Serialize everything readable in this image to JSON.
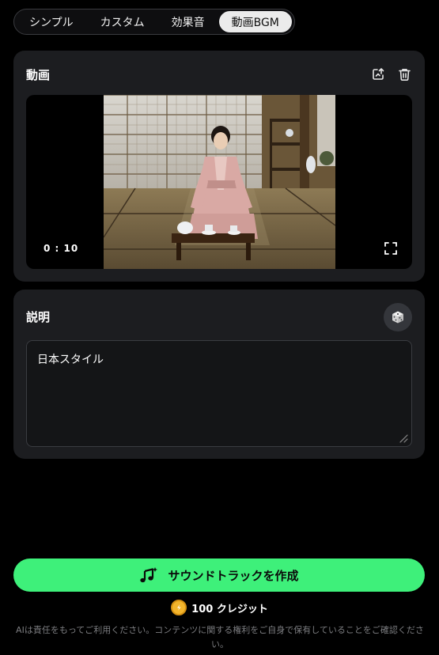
{
  "tabs": [
    {
      "label": "シンプル",
      "active": false
    },
    {
      "label": "カスタム",
      "active": false
    },
    {
      "label": "効果音",
      "active": false
    },
    {
      "label": "動画BGM",
      "active": true
    }
  ],
  "video_section": {
    "title": "動画",
    "time": "0 : 10",
    "icons": [
      "upload-icon",
      "trash-icon",
      "fullscreen-icon"
    ]
  },
  "description_section": {
    "title": "説明",
    "text": "日本スタイル",
    "icons": [
      "dice-icon"
    ]
  },
  "create_button": {
    "label": "サウンドトラックを作成",
    "icon": "music-sparkle-icon",
    "color": "#3ef07a"
  },
  "credits": {
    "label": "100 クレジット",
    "icon": "coin-icon"
  },
  "disclaimer": "AIは責任をもってご利用ください。コンテンツに関する権利をご自身で保有していることをご確認ください。"
}
